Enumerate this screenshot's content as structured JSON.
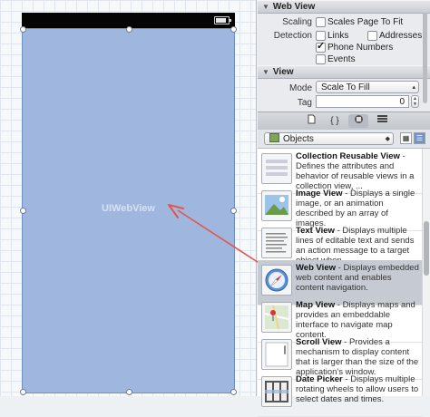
{
  "canvas": {
    "webview_label": "UIWebView"
  },
  "inspector": {
    "web_view_section": {
      "title": "Web View",
      "scaling_label": "Scaling",
      "scales_page_to_fit": {
        "label": "Scales Page To Fit",
        "checked": false
      },
      "detection_label": "Detection",
      "links": {
        "label": "Links",
        "checked": false
      },
      "addresses": {
        "label": "Addresses",
        "checked": false
      },
      "phone_numbers": {
        "label": "Phone Numbers",
        "checked": true
      },
      "events": {
        "label": "Events",
        "checked": false
      }
    },
    "view_section": {
      "title": "View",
      "mode_label": "Mode",
      "mode_value": "Scale To Fill",
      "tag_label": "Tag",
      "tag_value": "0"
    }
  },
  "library": {
    "tabs": [
      "file-template-icon",
      "code-snippet-icon",
      "object-library-icon",
      "media-library-icon"
    ],
    "selected_tab": 2,
    "filter": "Objects",
    "items": [
      {
        "title": "Collection Reusable View",
        "desc": " - Defines the attributes and behavior of reusable views in a collection view, ..."
      },
      {
        "title": "Image View",
        "desc": " - Displays a single image, or an animation described by an array of images."
      },
      {
        "title": "Text View",
        "desc": " - Displays multiple lines of editable text and sends an action message to a target object when..."
      },
      {
        "title": "Web View",
        "desc": " - Displays embedded web content and enables content navigation."
      },
      {
        "title": "Map View",
        "desc": " - Displays maps and provides an embeddable interface to navigate map content."
      },
      {
        "title": "Scroll View",
        "desc": " - Provides a mechanism to display content that is larger than the size of the application's window."
      },
      {
        "title": "Date Picker",
        "desc": " - Displays multiple rotating wheels to allow users to select dates and times."
      }
    ],
    "selected_item": 3
  },
  "colors": {
    "webview_fill": "#9fb7de",
    "arrow": "#e0574f",
    "selection": "#c6cbd3"
  }
}
